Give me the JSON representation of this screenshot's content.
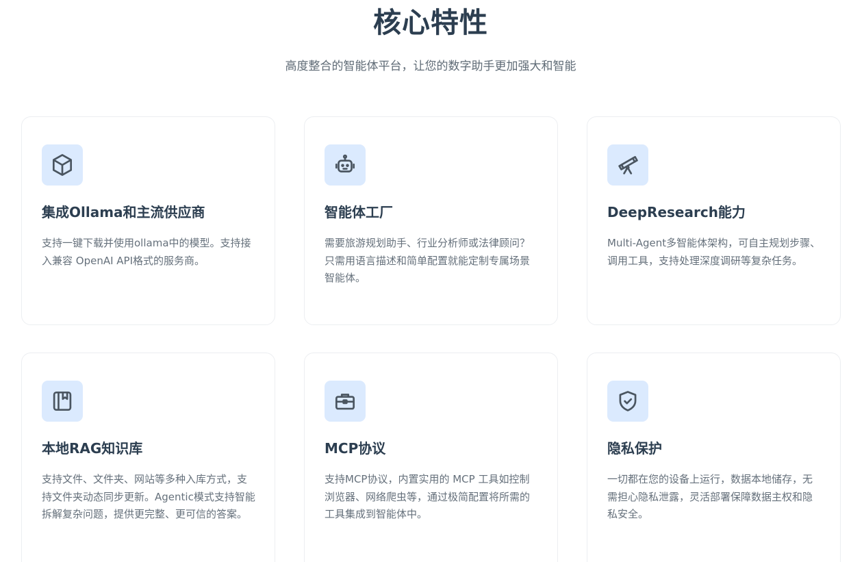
{
  "header": {
    "title": "核心特性",
    "subtitle": "高度整合的智能体平台，让您的数字助手更加强大和智能"
  },
  "features": [
    {
      "icon": "cube-icon",
      "title": "集成Ollama和主流供应商",
      "description": "支持一键下载并使用ollama中的模型。支持接入兼容 OpenAI API格式的服务商。"
    },
    {
      "icon": "robot-icon",
      "title": "智能体工厂",
      "description": "需要旅游规划助手、行业分析师或法律顾问？只需用语言描述和简单配置就能定制专属场景智能体。"
    },
    {
      "icon": "telescope-icon",
      "title": "DeepResearch能力",
      "description": "Multi-Agent多智能体架构，可自主规划步骤、调用工具，支持处理深度调研等复杂任务。"
    },
    {
      "icon": "book-icon",
      "title": "本地RAG知识库",
      "description": "支持文件、文件夹、网站等多种入库方式，支持文件夹动态同步更新。Agentic模式支持智能拆解复杂问题，提供更完整、更可信的答案。"
    },
    {
      "icon": "toolbox-icon",
      "title": "MCP协议",
      "description": "支持MCP协议，内置实用的 MCP 工具如控制浏览器、网络爬虫等，通过极简配置将所需的工具集成到智能体中。"
    },
    {
      "icon": "shield-check-icon",
      "title": "隐私保护",
      "description": "一切都在您的设备上运行，数据本地储存，无需担心隐私泄露，灵活部署保障数据主权和隐私安全。"
    }
  ],
  "colors": {
    "icon_background": "#dbeafe",
    "title_text": "#2c3e50",
    "body_text": "#65707b"
  }
}
